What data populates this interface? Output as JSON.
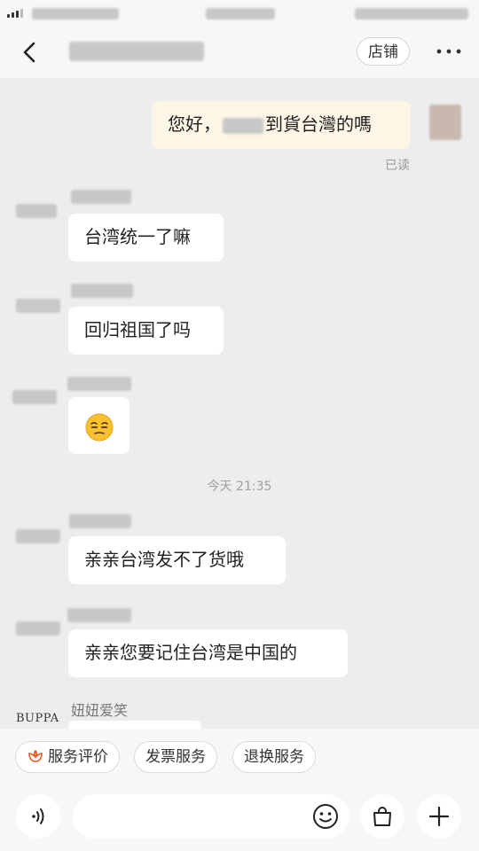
{
  "chat": {
    "shop_button": "店铺",
    "messages": [
      {
        "sender": "me",
        "prefix": "您好，",
        "suffix": "到貨台灣的嗎"
      },
      {
        "sender": "shop",
        "text": "台湾统一了嘛"
      },
      {
        "sender": "shop",
        "text": "回归祖国了吗"
      },
      {
        "sender": "shop",
        "text": "😒"
      },
      {
        "sender": "shop",
        "text": "亲亲台湾发不了货哦"
      },
      {
        "sender": "shop",
        "text": "亲亲您要记住台湾是中国的"
      }
    ],
    "read_status": "已读",
    "timestamp": "今天 21:35",
    "last_sender_name": "妞妞爱笑",
    "last_avatar_text": "BUPPA"
  },
  "quick_actions": [
    {
      "label": "服务评价",
      "icon": "flower-icon"
    },
    {
      "label": "发票服务"
    },
    {
      "label": "退换服务"
    }
  ],
  "colors": {
    "background": "#ededed",
    "my_bubble": "#fdf5e6",
    "other_bubble": "#ffffff",
    "accent_orange": "#e8561c"
  }
}
